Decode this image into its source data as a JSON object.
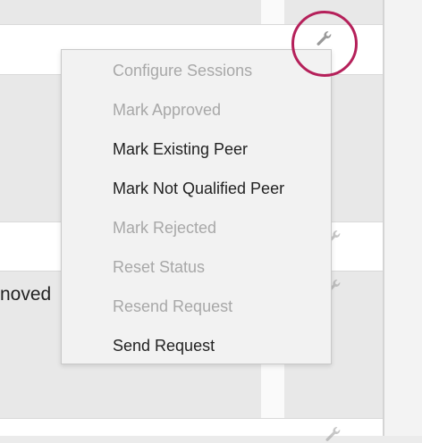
{
  "background_row": {
    "truncated_text": "noved"
  },
  "menu": {
    "items": [
      {
        "label": "Configure Sessions",
        "enabled": false
      },
      {
        "label": "Mark Approved",
        "enabled": false
      },
      {
        "label": "Mark Existing Peer",
        "enabled": true
      },
      {
        "label": "Mark Not Qualified Peer",
        "enabled": true
      },
      {
        "label": "Mark Rejected",
        "enabled": false
      },
      {
        "label": "Reset Status",
        "enabled": false
      },
      {
        "label": "Resend Request",
        "enabled": false
      },
      {
        "label": "Send Request",
        "enabled": true
      }
    ]
  },
  "colors": {
    "highlight": "#b5205a",
    "enabled_text": "#222222",
    "disabled_text": "#a8a8a8"
  },
  "icons": {
    "actions": "wrench-icon"
  }
}
